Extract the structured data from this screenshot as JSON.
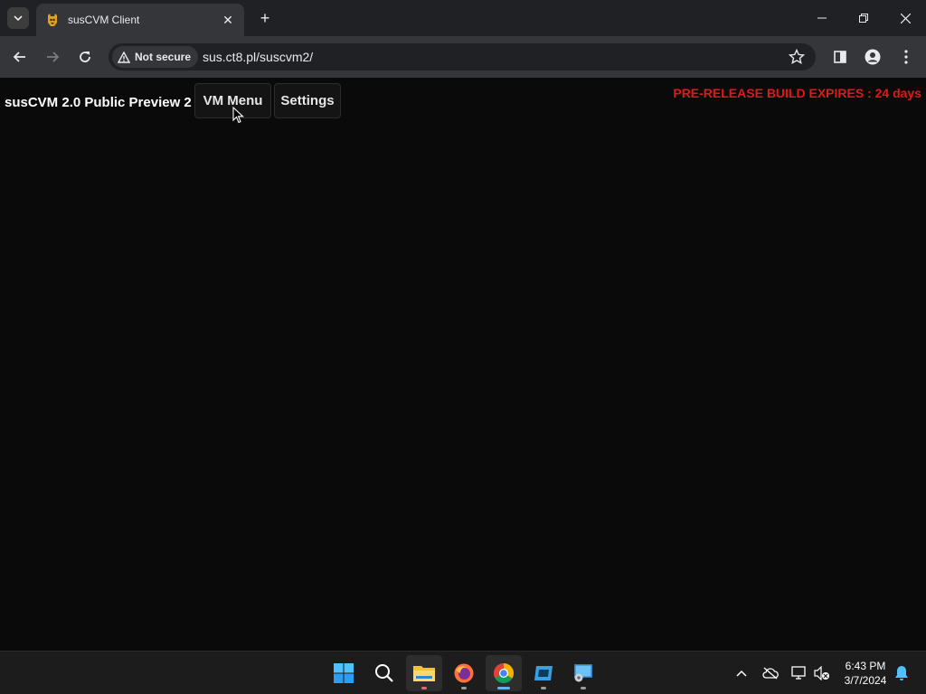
{
  "browser": {
    "tab_title": "susCVM Client",
    "security_label": "Not secure",
    "url": "sus.ct8.pl/suscvm2/"
  },
  "app": {
    "title": "susCVM 2.0 Public Preview 2",
    "vm_menu_label": "VM Menu",
    "settings_label": "Settings",
    "expiry_notice": "PRE-RELEASE BUILD EXPIRES : 24 days",
    "expiry_color": "#e01818"
  },
  "taskbar": {
    "apps": [
      "start-icon",
      "search-icon",
      "file-explorer-icon",
      "firefox-icon",
      "chrome-icon",
      "app-icon",
      "remote-desktop-icon"
    ],
    "time": "6:43 PM",
    "date": "3/7/2024"
  }
}
